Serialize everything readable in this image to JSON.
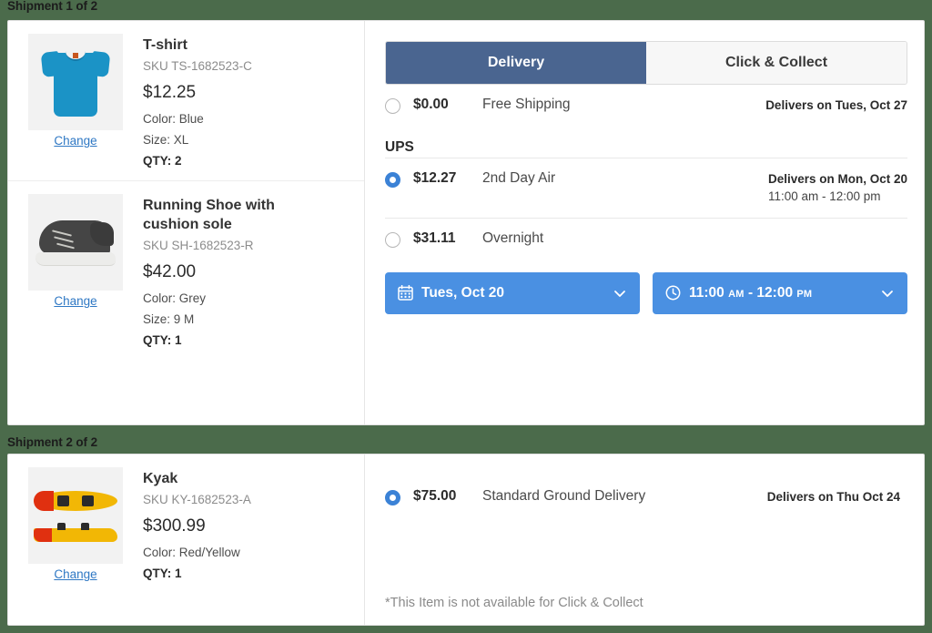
{
  "theme": {
    "page_background": "#4b6b4b",
    "active_tab_color": "#4a6590",
    "pill_color": "#4a90e2",
    "radio_selected_color": "#3b82d6",
    "link_color": "#2f78c4"
  },
  "shipments": [
    {
      "label": "Shipment 1 of 2",
      "items": [
        {
          "name": "T-shirt",
          "sku": "SKU TS-1682523-C",
          "price": "$12.25",
          "color": "Color: Blue",
          "size": "Size: XL",
          "qty": "QTY: 2",
          "change_label": "Change",
          "image_name": "tshirt-thumbnail"
        },
        {
          "name": "Running Shoe with cushion sole",
          "sku": "SKU SH-1682523-R",
          "price": "$42.00",
          "color": "Color: Grey",
          "size": "Size: 9 M",
          "qty": "QTY: 1",
          "change_label": "Change",
          "image_name": "running-shoe-thumbnail"
        }
      ],
      "tabs": [
        {
          "label": "Delivery",
          "active": true
        },
        {
          "label": "Click & Collect",
          "active": false
        }
      ],
      "free_option": {
        "price": "$0.00",
        "name": "Free Shipping",
        "eta": "Delivers on Tues, Oct 27",
        "selected": false
      },
      "carrier": "UPS",
      "carrier_options": [
        {
          "price": "$12.27",
          "name": "2nd Day Air",
          "eta": "Delivers on Mon, Oct 20",
          "eta_window": "11:00 am - 12:00 pm",
          "selected": true
        },
        {
          "price": "$31.11",
          "name": "Overnight",
          "eta": "",
          "eta_window": "",
          "selected": false
        }
      ],
      "date_picker": {
        "icon": "calendar-icon",
        "value": "Tues, Oct 20",
        "caret": "chevron-down-icon"
      },
      "time_picker": {
        "icon": "clock-icon",
        "start_time": "11:00",
        "start_meridiem": "AM",
        "separator": "-",
        "end_time": "12:00",
        "end_meridiem": "PM",
        "caret": "chevron-down-icon"
      }
    },
    {
      "label": "Shipment 2 of 2",
      "items": [
        {
          "name": "Kyak",
          "sku": "SKU KY-1682523-A",
          "price": "$300.99",
          "color": "Color: Red/Yellow",
          "size": "",
          "qty": "QTY: 1",
          "change_label": "Change",
          "image_name": "kayak-thumbnail"
        }
      ],
      "option": {
        "price": "$75.00",
        "name": "Standard Ground Delivery",
        "eta": "Delivers on Thu Oct 24",
        "selected": true
      },
      "note": "*This Item is not available for Click & Collect"
    }
  ]
}
